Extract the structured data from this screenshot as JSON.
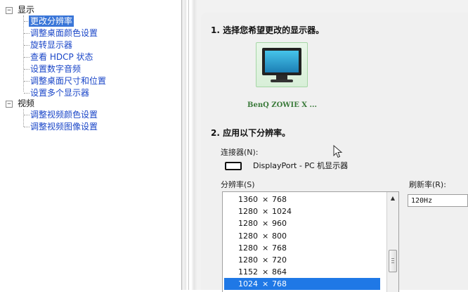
{
  "tree": {
    "display_category": "显示",
    "display_items": [
      {
        "label": "更改分辨率",
        "selected": true
      },
      {
        "label": "调整桌面颜色设置",
        "selected": false
      },
      {
        "label": "旋转显示器",
        "selected": false
      },
      {
        "label": "查看 HDCP 状态",
        "selected": false
      },
      {
        "label": "设置数字音频",
        "selected": false
      },
      {
        "label": "调整桌面尺寸和位置",
        "selected": false
      },
      {
        "label": "设置多个显示器",
        "selected": false
      }
    ],
    "video_category": "视频",
    "video_items": [
      {
        "label": "调整视频颜色设置"
      },
      {
        "label": "调整视频图像设置"
      }
    ],
    "expander_symbol": "−"
  },
  "section1": {
    "title": "1. 选择您希望更改的显示器。",
    "monitor_label": "BenQ ZOWIE X ..."
  },
  "section2": {
    "title": "2. 应用以下分辨率。",
    "connector_label": "连接器(N):",
    "connector_value": "DisplayPort - PC 机显示器",
    "resolution_label": "分辨率(S)",
    "refresh_label": "刷新率(R):",
    "refresh_value": "120Hz",
    "resolutions": [
      {
        "w": "1360",
        "h": "768",
        "selected": false
      },
      {
        "w": "1280",
        "h": "1024",
        "selected": false
      },
      {
        "w": "1280",
        "h": "960",
        "selected": false
      },
      {
        "w": "1280",
        "h": "800",
        "selected": false
      },
      {
        "w": "1280",
        "h": "768",
        "selected": false
      },
      {
        "w": "1280",
        "h": "720",
        "selected": false
      },
      {
        "w": "1152",
        "h": "864",
        "selected": false
      },
      {
        "w": "1024",
        "h": "768",
        "selected": true
      }
    ],
    "times_symbol": "×"
  },
  "icons": {
    "scroll_up": "▲"
  },
  "colors": {
    "selection": "#1f78e6",
    "tree_link": "#1a46c8",
    "monitor_highlight": "#a6d6a6"
  }
}
